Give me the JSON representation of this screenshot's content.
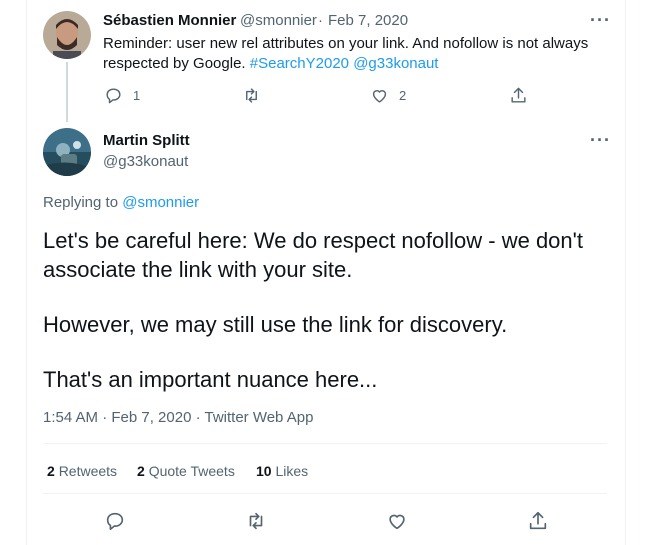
{
  "parent_tweet": {
    "author_name": "Sébastien Monnier",
    "handle": "@smonnier",
    "separator": "·",
    "date": "Feb 7, 2020",
    "text_plain": "Reminder: user new rel attributes on your link. And nofollow is not always respected by Google.",
    "hashtag": "#SearchY2020",
    "mention": "@g33konaut",
    "reply_count": "1",
    "like_count": "2",
    "more_label": "···"
  },
  "main_tweet": {
    "author_name": "Martin Splitt",
    "handle": "@g33konaut",
    "replying_prefix": "Replying to",
    "replying_to": "@smonnier",
    "paragraphs": [
      "Let's be careful here: We do respect nofollow - we don't associate the link with your site.",
      "However, we may still use the link for discovery.",
      "That's an important nuance here..."
    ],
    "meta": "1:54 AM · Feb 7, 2020 · Twitter Web App",
    "more_label": "···"
  },
  "stats": {
    "retweets_count": "2",
    "retweets_label": "Retweets",
    "quotes_count": "2",
    "quotes_label": "Quote Tweets",
    "likes_count": "10",
    "likes_label": "Likes"
  },
  "icons": {
    "reply": "reply-icon",
    "retweet": "retweet-icon",
    "like": "heart-icon",
    "share": "share-icon",
    "more": "more-icon"
  },
  "colors": {
    "link": "#1d9bf0",
    "text": "#0f1419",
    "muted": "#536471",
    "divider": "#eff3f4"
  }
}
